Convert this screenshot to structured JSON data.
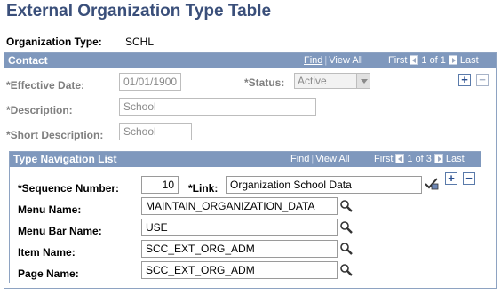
{
  "page": {
    "title": "External Organization Type Table",
    "org_type_label": "Organization Type:",
    "org_type_value": "SCHL"
  },
  "contact": {
    "header": "Contact",
    "nav": {
      "find": "Find",
      "view_all": "View All",
      "first": "First",
      "count": "1 of 1",
      "last": "Last"
    },
    "effective_date_label": "*Effective Date:",
    "effective_date_value": "01/01/1900",
    "status_label": "*Status:",
    "status_value": "Active",
    "description_label": "*Description:",
    "description_value": "School",
    "short_description_label": "*Short Description:",
    "short_description_value": "School",
    "add_label": "+",
    "remove_label": "−"
  },
  "type_nav": {
    "header": "Type Navigation List",
    "nav": {
      "find": "Find",
      "view_all": "View All",
      "first": "First",
      "count": "1 of 3",
      "last": "Last"
    },
    "sequence_label": "*Sequence Number:",
    "sequence_value": "10",
    "link_label": "*Link:",
    "link_value": "Organization School Data",
    "menu_name_label": "Menu Name:",
    "menu_name_value": "MAINTAIN_ORGANIZATION_DATA",
    "menu_bar_label": "Menu Bar Name:",
    "menu_bar_value": "USE",
    "item_name_label": "Item Name:",
    "item_name_value": "SCC_EXT_ORG_ADM",
    "page_name_label": "Page Name:",
    "page_name_value": "SCC_EXT_ORG_ADM",
    "add_label": "+",
    "remove_label": "−"
  },
  "colors": {
    "title": "#3a4f7a",
    "header_bg": "#7f98bd",
    "border": "#8ea3c2"
  },
  "icons": [
    "lookup-magnifier-icon",
    "spell-check-icon",
    "prev-arrow-icon",
    "next-arrow-icon"
  ]
}
